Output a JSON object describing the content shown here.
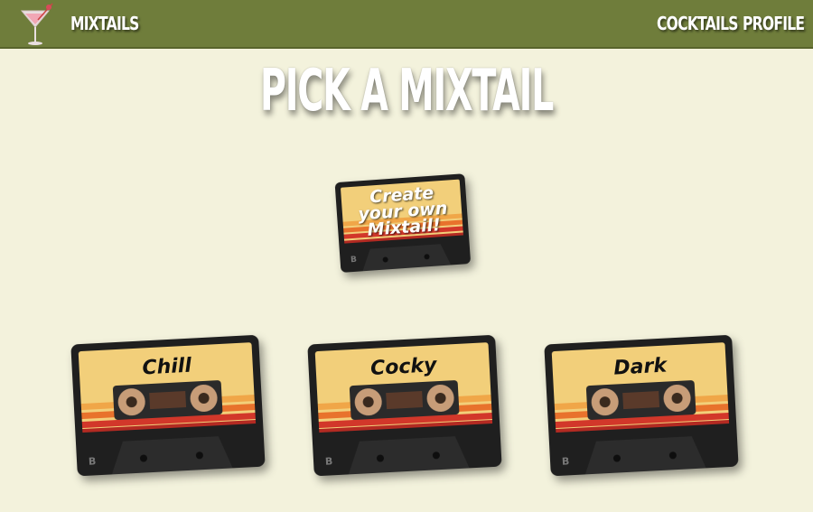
{
  "nav": {
    "brand": "MIXTAILS",
    "links": [
      {
        "label": "COCKTAILS"
      },
      {
        "label": "PROFILE"
      }
    ]
  },
  "main": {
    "title": "PICK A MIXTAIL",
    "create_tape": {
      "lines": [
        "Create",
        "your own",
        "Mixtail!"
      ],
      "side": "B"
    },
    "mood_tapes": [
      {
        "label": "Chill",
        "side": "B"
      },
      {
        "label": "Cocky",
        "side": "B"
      },
      {
        "label": "Dark",
        "side": "B"
      }
    ]
  },
  "colors": {
    "background": "#f3f2dc",
    "navbar": "#6f7d3b",
    "label_yellow": "#f2cf7a",
    "stripe_orange": "#e8722c",
    "stripe_red": "#d2372a",
    "cassette_body": "#1f1f1f"
  },
  "icons": {
    "logo": "martini-glass-icon"
  }
}
